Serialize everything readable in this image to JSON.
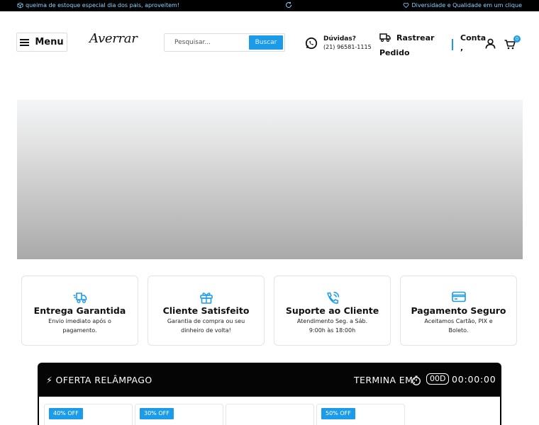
{
  "topbar": {
    "left_text": "queima de estoque especial dia dos pais, aproveitem!",
    "right_text": "Diversidade e Qualidade em um clique",
    "accent": "#8fd3ff"
  },
  "header": {
    "menu_label": "Menu",
    "logo_text": "Averrar",
    "search": {
      "placeholder": "Pesquisar...",
      "button_label": "Buscar"
    },
    "support": {
      "title": "Dúvidas?",
      "phone": "(21) 96581-1115"
    },
    "track": {
      "line1": "Rastrear",
      "line2": "Pedido"
    },
    "account": {
      "label": "Conta",
      "sub": ","
    },
    "cart_count": "0"
  },
  "features": [
    {
      "icon": "truck-speed-icon",
      "title": "Entrega Garantida",
      "desc": "Envio imediato após o pagamento."
    },
    {
      "icon": "gift-box-icon",
      "title": "Cliente Satisfeito",
      "desc": "Garantia de compra ou seu dinheiro de volta!"
    },
    {
      "icon": "phone-call-icon",
      "title": "Suporte ao Cliente",
      "desc": "Atendimento Seg. a Sáb. 9:00h às 18:00h"
    },
    {
      "icon": "credit-card-icon",
      "title": "Pagamento Seguro",
      "desc": "Aceitamos Cartão, PIX e Boleto."
    }
  ],
  "flash_sale": {
    "title": "⚡ OFERTA RELÂMPAGO",
    "ends_label": "TERMINA EM:",
    "days": "00D",
    "time": "00:00:00",
    "products": [
      {
        "badge": "40% OFF"
      },
      {
        "badge": "30% OFF"
      },
      {
        "badge": ""
      },
      {
        "badge": "50% OFF"
      }
    ]
  },
  "colors": {
    "accent": "#1b9be8",
    "topbar_bg": "#000000",
    "flash_bg": "#050505"
  }
}
